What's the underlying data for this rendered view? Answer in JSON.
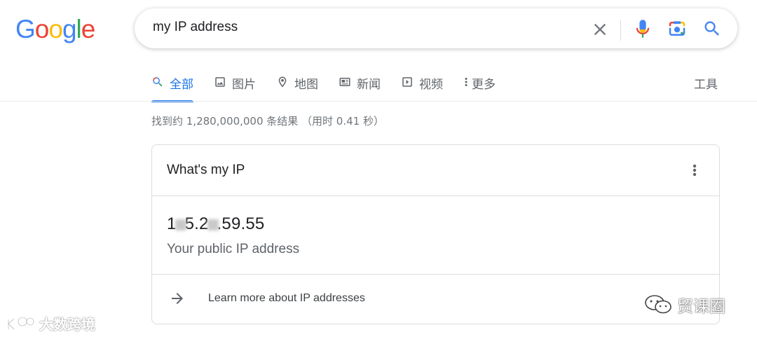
{
  "logo": {
    "text": "Google",
    "letters": [
      "G",
      "o",
      "o",
      "g",
      "l",
      "e"
    ]
  },
  "search": {
    "query": "my IP address"
  },
  "tabs": [
    {
      "label": "全部",
      "icon": "search-icon",
      "active": true
    },
    {
      "label": "图片",
      "icon": "image-icon",
      "active": false
    },
    {
      "label": "地图",
      "icon": "map-pin-icon",
      "active": false
    },
    {
      "label": "新闻",
      "icon": "news-icon",
      "active": false
    },
    {
      "label": "视频",
      "icon": "video-icon",
      "active": false
    },
    {
      "label": "更多",
      "icon": "more-vert-icon",
      "active": false
    }
  ],
  "tools_label": "工具",
  "result_stats": "找到约 1,280,000,000 条结果 （用时 0.41 秒）",
  "card": {
    "title": "What's my IP",
    "ip_parts": [
      "1",
      "5.2",
      ".59.55"
    ],
    "ip_caption": "Your public IP address",
    "learn_more": "Learn more about IP addresses"
  },
  "watermarks": {
    "left": "大数跨境",
    "right": "贸课圈"
  },
  "colors": {
    "accent": "#1a73e8",
    "google_blue": "#4285F4",
    "google_red": "#EA4335",
    "google_yellow": "#FBBC05",
    "google_green": "#34A853"
  }
}
